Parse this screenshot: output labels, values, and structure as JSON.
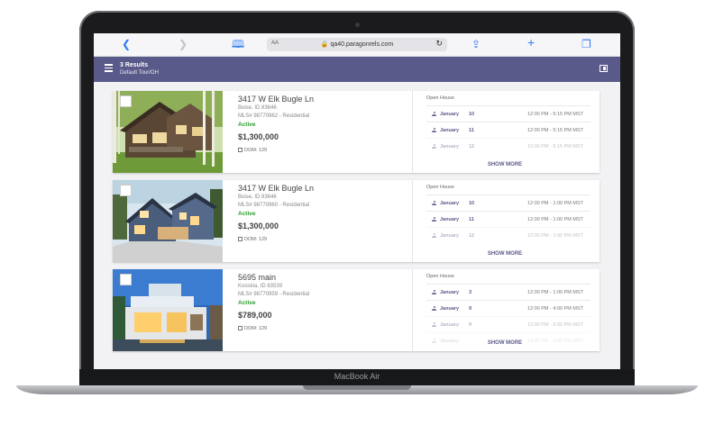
{
  "device": {
    "brand_label": "MacBook Air"
  },
  "browser": {
    "url": "qa40.paragonrels.com",
    "text_size_label": "AA",
    "icons": [
      "back-icon",
      "forward-icon",
      "bookmarks-icon",
      "lock-icon",
      "reload-icon",
      "share-icon",
      "new-tab-icon",
      "tabs-icon"
    ]
  },
  "header": {
    "results": "3 Results",
    "subtitle": "Default Tour/OH",
    "colors": {
      "bar": "#5a5a8a"
    }
  },
  "listings": [
    {
      "address": "3417 W Elk Bugle Ln",
      "city": "Boise, ID 83646",
      "mls": "MLS# 98770962 - Residential",
      "status": "Active",
      "price": "$1,300,000",
      "dom": "DOM: 129",
      "open_house_label": "Open House",
      "open_houses": [
        {
          "month": "January",
          "day": "10",
          "time": "12:00 PM - 5:15 PM MST"
        },
        {
          "month": "January",
          "day": "11",
          "time": "12:00 PM - 5:15 PM MST"
        },
        {
          "month": "January",
          "day": "12",
          "time": "12:00 PM - 5:15 PM MST"
        }
      ],
      "show_more": "SHOW MORE"
    },
    {
      "address": "3417 W Elk Bugle Ln",
      "city": "Boise, ID 83646",
      "mls": "MLS# 98770960 - Residential",
      "status": "Active",
      "price": "$1,300,000",
      "dom": "DOM: 129",
      "open_house_label": "Open House",
      "open_houses": [
        {
          "month": "January",
          "day": "10",
          "time": "12:00 PM - 1:00 PM MST"
        },
        {
          "month": "January",
          "day": "11",
          "time": "12:00 PM - 1:00 PM MST"
        },
        {
          "month": "January",
          "day": "12",
          "time": "12:00 PM - 1:00 PM MST"
        }
      ],
      "show_more": "SHOW MORE"
    },
    {
      "address": "5695 main",
      "city": "Kooskia, ID 83539",
      "mls": "MLS# 98770959 - Residential",
      "status": "Active",
      "price": "$789,000",
      "dom": "DOM: 129",
      "open_house_label": "Open House",
      "open_houses": [
        {
          "month": "January",
          "day": "3",
          "time": "12:00 PM - 1:00 PM MST"
        },
        {
          "month": "January",
          "day": "9",
          "time": "12:00 PM - 4:00 PM MST"
        },
        {
          "month": "January",
          "day": "9",
          "time": "12:00 PM - 5:00 PM MST"
        },
        {
          "month": "January",
          "day": "",
          "time": "12:00 PM - 5:00 PM MST"
        }
      ],
      "show_more": "SHOW MORE"
    }
  ]
}
